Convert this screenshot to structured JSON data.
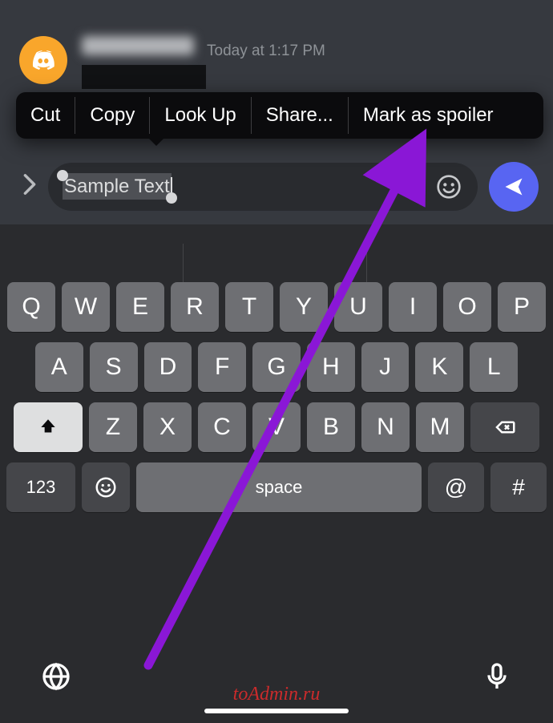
{
  "message": {
    "timestamp": "Today at 1:17 PM"
  },
  "context_menu": {
    "items": [
      "Cut",
      "Copy",
      "Look Up",
      "Share...",
      "Mark as spoiler"
    ]
  },
  "input": {
    "text": "Sample Text"
  },
  "keyboard": {
    "row1": [
      "Q",
      "W",
      "E",
      "R",
      "T",
      "Y",
      "U",
      "I",
      "O",
      "P"
    ],
    "row2": [
      "A",
      "S",
      "D",
      "F",
      "G",
      "H",
      "J",
      "K",
      "L"
    ],
    "row3": [
      "Z",
      "X",
      "C",
      "V",
      "B",
      "N",
      "M"
    ],
    "numbers_key": "123",
    "space_label": "space",
    "at_key": "@",
    "hash_key": "#"
  },
  "watermark": "toAdmin.ru",
  "colors": {
    "accent_send": "#5865f2",
    "avatar": "#f9a62b",
    "arrow": "#8a17d6"
  }
}
